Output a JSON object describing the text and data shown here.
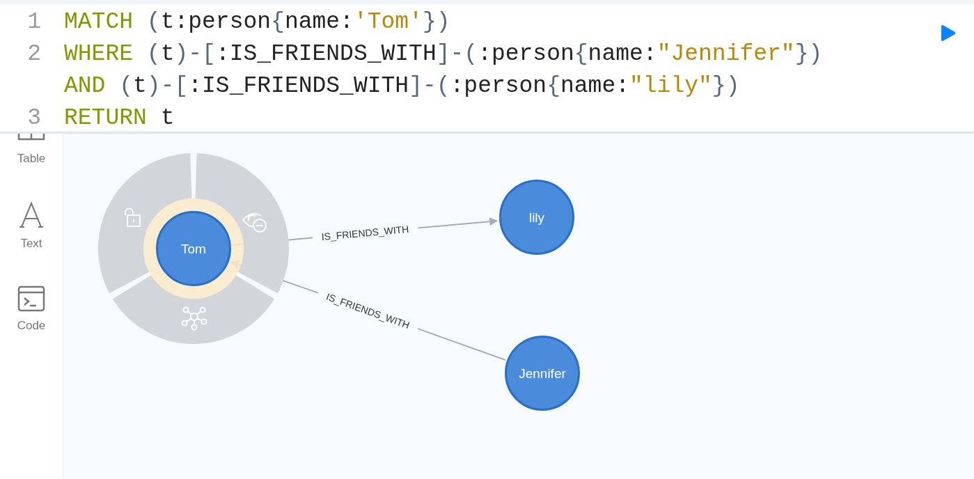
{
  "editor": {
    "lines": [
      {
        "number": "1",
        "tokens": [
          {
            "kind": "keyword",
            "text": "MATCH"
          },
          {
            "kind": "punct",
            "text": " ("
          },
          {
            "kind": "plain",
            "text": "t:person"
          },
          {
            "kind": "punct",
            "text": "{"
          },
          {
            "kind": "plain",
            "text": "name:"
          },
          {
            "kind": "string",
            "text": "'Tom'"
          },
          {
            "kind": "punct",
            "text": "})"
          }
        ]
      },
      {
        "number": "2",
        "tokens": [
          {
            "kind": "keyword",
            "text": "WHERE"
          },
          {
            "kind": "punct",
            "text": " ("
          },
          {
            "kind": "plain",
            "text": "t"
          },
          {
            "kind": "punct",
            "text": ")-["
          },
          {
            "kind": "plain",
            "text": ":IS_FRIENDS_WITH"
          },
          {
            "kind": "punct",
            "text": "]-("
          },
          {
            "kind": "plain",
            "text": ":person"
          },
          {
            "kind": "punct",
            "text": "{"
          },
          {
            "kind": "plain",
            "text": "name:"
          },
          {
            "kind": "string",
            "text": "\"Jennifer\""
          },
          {
            "kind": "punct",
            "text": "})"
          }
        ]
      },
      {
        "tokens": [
          {
            "kind": "keyword",
            "text": "AND"
          },
          {
            "kind": "punct",
            "text": " ("
          },
          {
            "kind": "plain",
            "text": "t"
          },
          {
            "kind": "punct",
            "text": ")-["
          },
          {
            "kind": "plain",
            "text": ":IS_FRIENDS_WITH"
          },
          {
            "kind": "punct",
            "text": "]-("
          },
          {
            "kind": "plain",
            "text": ":person"
          },
          {
            "kind": "punct",
            "text": "{"
          },
          {
            "kind": "plain",
            "text": "name:"
          },
          {
            "kind": "string",
            "text": "\"lily\""
          },
          {
            "kind": "punct",
            "text": "})"
          }
        ]
      },
      {
        "number": "3",
        "tokens": [
          {
            "kind": "keyword",
            "text": "RETURN"
          },
          {
            "kind": "plain",
            "text": " t"
          }
        ]
      }
    ]
  },
  "sidebar": {
    "items": [
      {
        "kind": "table",
        "label": "Table"
      },
      {
        "kind": "text",
        "label": "Text"
      },
      {
        "kind": "code",
        "label": "Code"
      }
    ]
  },
  "graph": {
    "nodes": [
      {
        "label": "Tom",
        "selected": true
      },
      {
        "label": "lily",
        "selected": false
      },
      {
        "label": "Jennifer",
        "selected": false
      }
    ],
    "edges": [
      {
        "label": "IS_FRIENDS_WITH",
        "arrow_toward_node": true
      },
      {
        "label": "IS_FRIENDS_WITH",
        "arrow_toward_node": false
      }
    ]
  }
}
